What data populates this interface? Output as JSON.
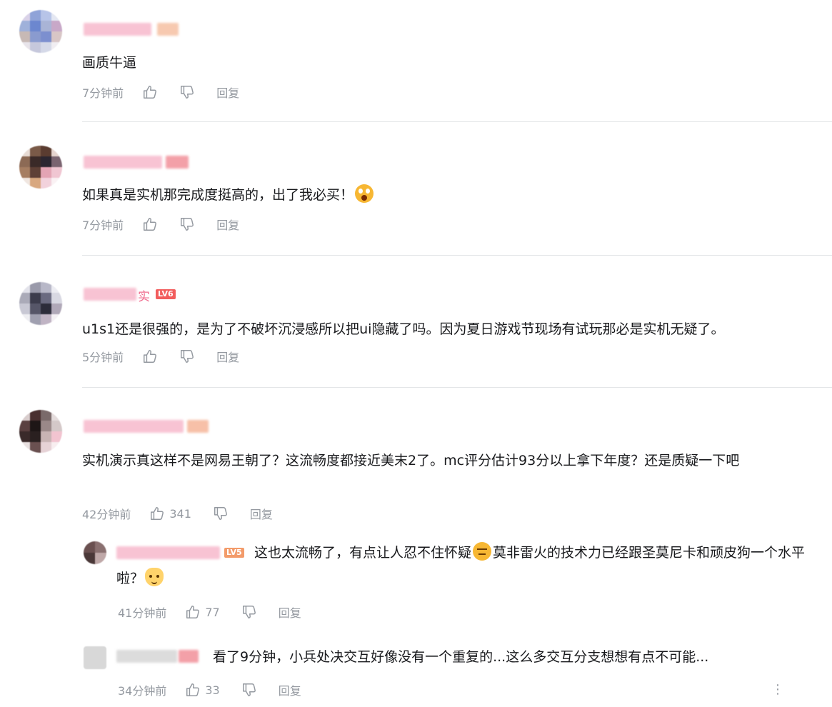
{
  "comments": [
    {
      "text": "画质牛逼",
      "time": "7分钟前",
      "like_count": "",
      "reply_label": "回复"
    },
    {
      "text": "如果真是实机那完成度挺高的，出了我必买！",
      "time": "7分钟前",
      "like_count": "",
      "reply_label": "回复"
    },
    {
      "name_fragment": "实",
      "level": "LV6",
      "text": "u1s1还是很强的，是为了不破坏沉浸感所以把ui隐藏了吗。因为夏日游戏节现场有试玩那必是实机无疑了。",
      "time": "5分钟前",
      "like_count": "",
      "reply_label": "回复"
    },
    {
      "text": "实机演示真这样不是网易王朝了？这流畅度都接近美末2了。mc评分估计93分以上拿下年度？还是质疑一下吧",
      "time": "42分钟前",
      "like_count": "341",
      "reply_label": "回复",
      "replies": [
        {
          "level": "LV5",
          "text_a": "这也太流畅了，有点让人忍不住怀疑",
          "text_b": "莫非雷火的技术力已经跟圣莫尼卡和顽皮狗一个水平啦？",
          "time": "41分钟前",
          "like_count": "77",
          "reply_label": "回复"
        },
        {
          "text": "看了9分钟，小兵处决交互好像没有一个重复的...这么多交互分支想想有点不可能...",
          "time": "34分钟前",
          "like_count": "33",
          "reply_label": "回复",
          "more": "⋮"
        }
      ]
    }
  ],
  "icons": {
    "like": "thumb-up-icon",
    "dislike": "thumb-down-icon",
    "emoji_1": "shocked-face-emoji",
    "emoji_2": "doubt-face-emoji",
    "emoji_3": "cat-face-emoji"
  },
  "colors": {
    "meta_text": "#9499a0",
    "badge": "#f25d5d",
    "username_blur": "#f7b6c8",
    "divider": "#e3e5e7"
  }
}
